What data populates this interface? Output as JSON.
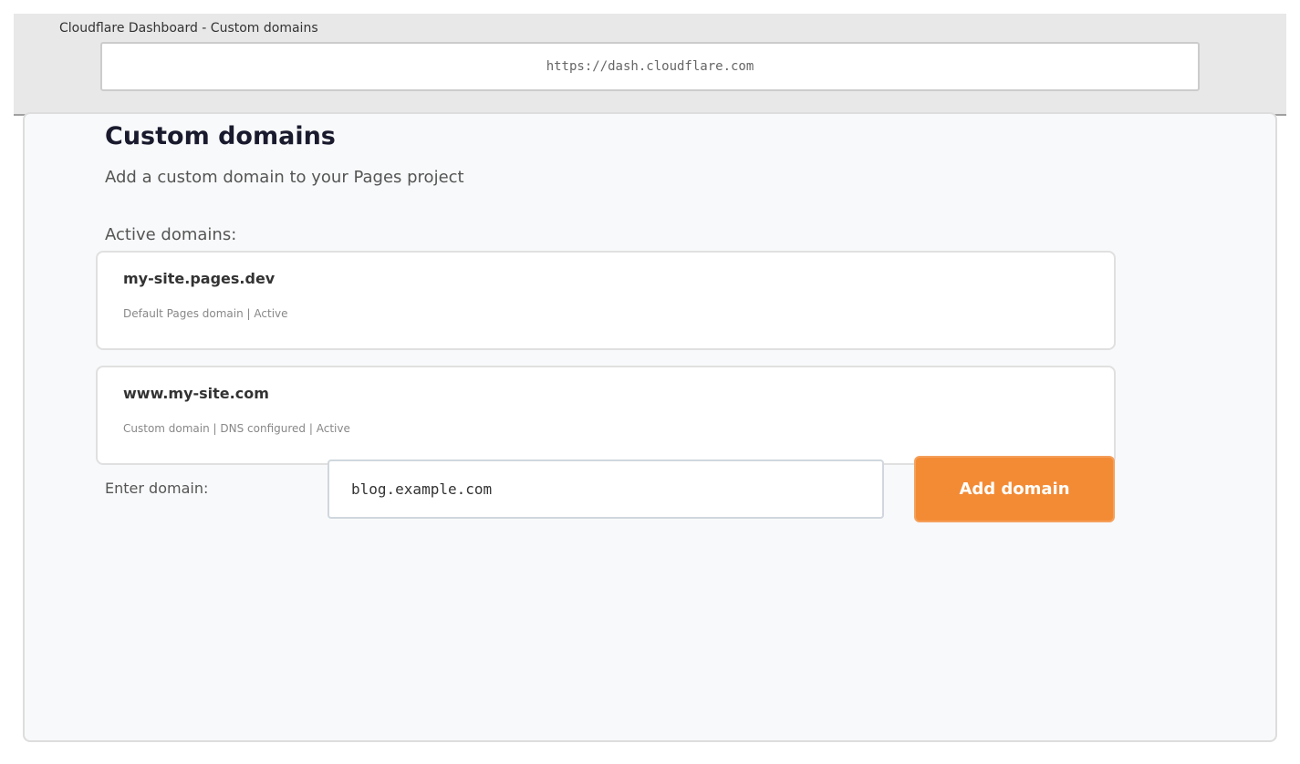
{
  "window": {
    "title": "Cloudflare Dashboard - Custom domains",
    "url": "https://dash.cloudflare.com"
  },
  "page": {
    "title": "Custom domains",
    "subtitle": "Add a custom domain to your Pages project",
    "active_label": "Active domains:"
  },
  "domains": [
    {
      "name": "my-site.pages.dev",
      "meta": "Default Pages domain | Active"
    },
    {
      "name": "www.my-site.com",
      "meta": "Custom domain | DNS configured | Active"
    }
  ],
  "form": {
    "label": "Enter domain:",
    "value": "blog.example.com",
    "button_label": "Add domain"
  },
  "colors": {
    "accent": "#f38b35",
    "title": "#1a1a2e"
  }
}
